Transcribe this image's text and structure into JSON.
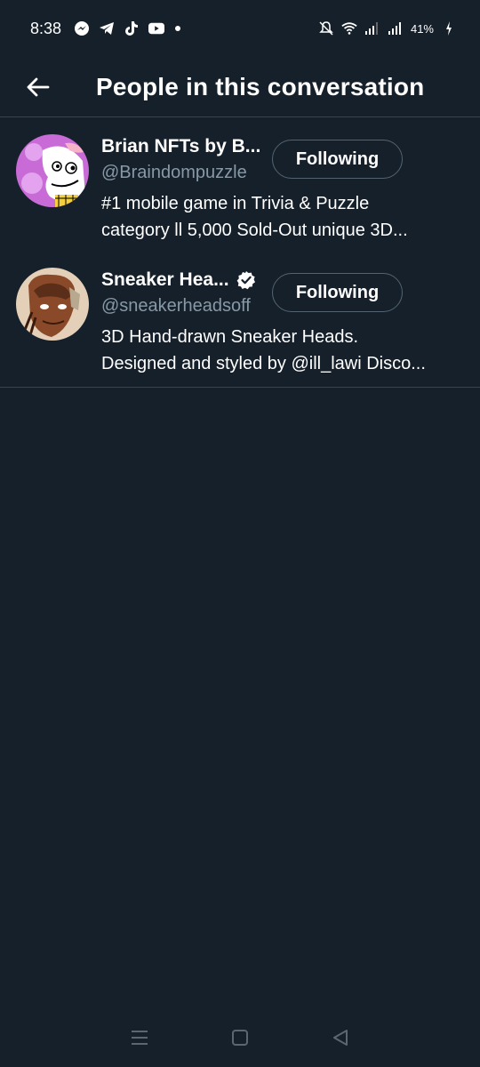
{
  "status_bar": {
    "time": "8:38",
    "battery": "41%",
    "icons": [
      "messenger-icon",
      "telegram-icon",
      "tiktok-icon",
      "youtube-icon",
      "dot-icon",
      "mute-icon",
      "wifi-icon",
      "signal-icon",
      "signal-icon",
      "battery-charging-icon"
    ]
  },
  "header": {
    "title": "People in this conversation",
    "back_icon": "arrow-left-icon"
  },
  "users": [
    {
      "display_name": "Brian NFTs by B...",
      "handle": "@Braindompuzzle",
      "bio_line1": "#1 mobile game in Trivia & Puzzle",
      "bio_line2": "category ll  5,000 Sold-Out unique 3D...",
      "follow_label": "Following",
      "verified": false
    },
    {
      "display_name": "Sneaker Hea...",
      "handle": "@sneakerheadsoff",
      "bio_line1": "3D Hand-drawn Sneaker Heads.",
      "bio_line2": "Designed and styled by @ill_lawi Disco...",
      "follow_label": "Following",
      "verified": true
    }
  ],
  "nav_bar": {
    "icons": [
      "recents-icon",
      "home-icon",
      "back-triangle-icon"
    ]
  },
  "colors": {
    "background": "#15202b",
    "divider": "#38444d",
    "secondary_text": "#8899a6",
    "accent": "#1d9bf0"
  }
}
